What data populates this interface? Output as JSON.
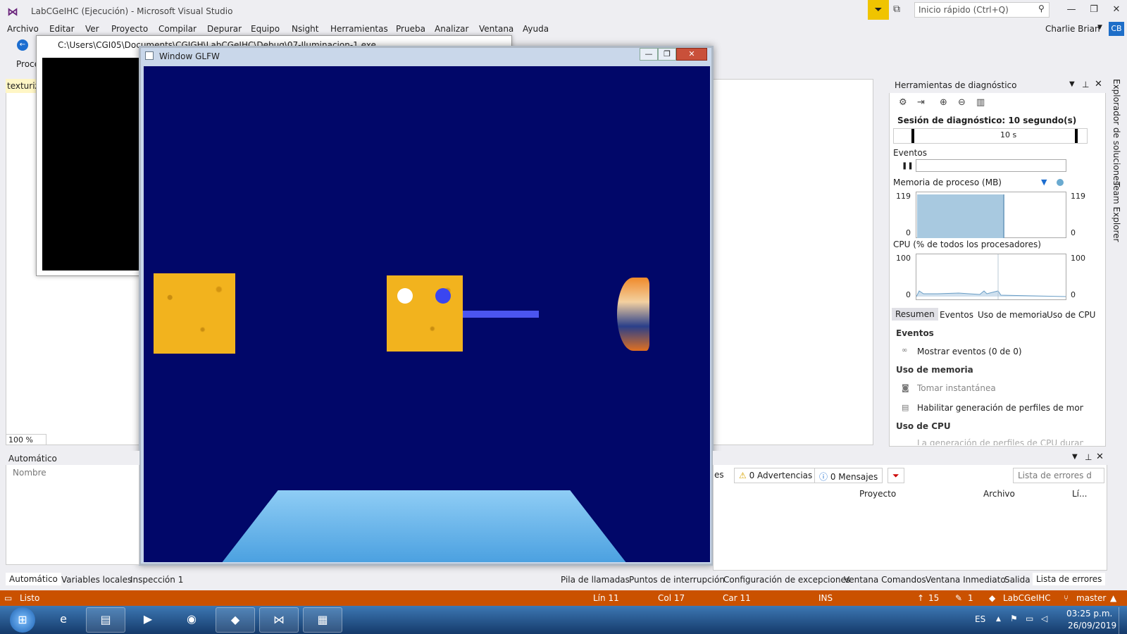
{
  "window": {
    "title": "LabCGeIHC (Ejecución) - Microsoft Visual Studio"
  },
  "quick_launch": {
    "placeholder": "Inicio rápido (Ctrl+Q)"
  },
  "menu": [
    "Archivo",
    "Editar",
    "Ver",
    "Proyecto",
    "Compilar",
    "Depurar",
    "Equipo",
    "Nsight",
    "Herramientas",
    "Prueba",
    "Analizar",
    "Ventana",
    "Ayuda"
  ],
  "user": {
    "name": "Charlie Brian",
    "initials": "CB"
  },
  "toolbar": {
    "process_label": "Proce"
  },
  "editor": {
    "tab": "texturiza",
    "zoom": "100 %"
  },
  "console": {
    "title": "C:\\Users\\CGI05\\Documents\\CGIGH\\LabCGeIHC\\Debug\\07-Iluminacion-1.exe"
  },
  "glfw": {
    "title": "Window GLFW"
  },
  "diagnostics": {
    "title": "Herramientas de diagnóstico",
    "session": "Sesión de diagnóstico: 10 segundo(s)",
    "time_label": "10 s",
    "events_label": "Eventos",
    "memory_label": "Memoria de proceso (MB)",
    "memory_max": "119",
    "memory_min": "0",
    "cpu_label": "CPU (% de todos los procesadores)",
    "cpu_max": "100",
    "cpu_min": "0",
    "tabs": [
      "Resumen",
      "Eventos",
      "Uso de memoria",
      "Uso de CPU"
    ],
    "events_section": "Eventos",
    "show_events": "Mostrar eventos (0 de 0)",
    "memory_section": "Uso de memoria",
    "take_snapshot": "Tomar instantánea",
    "enable_heap": "Habilitar generación de perfiles de montón (a",
    "cpu_section": "Uso de CPU",
    "cpu_note": "La generación de perfiles de CPU durante la d"
  },
  "sidebar_right": [
    "Explorador de soluciones",
    "Team Explorer"
  ],
  "autos": {
    "title": "Automático",
    "column": "Nombre"
  },
  "error_list": {
    "warnings": "0 Advertencias",
    "messages": "0 Mensajes",
    "errors_partial": "es",
    "search_placeholder": "Lista de errores d",
    "columns": [
      "Proyecto",
      "Archivo",
      "Lí..."
    ]
  },
  "bottom_tabs_left": [
    "Automático",
    "Variables locales",
    "Inspección 1"
  ],
  "bottom_tabs_right": [
    "Pila de llamadas",
    "Puntos de interrupción",
    "Configuración de excepciones",
    "Ventana Comandos",
    "Ventana Inmediato",
    "Salida",
    "Lista de errores"
  ],
  "status": {
    "state": "Listo",
    "line": "Lín 11",
    "col": "Col 17",
    "char": "Car 11",
    "mode": "INS",
    "push": "15",
    "edits": "1",
    "repo": "LabCGeIHC",
    "branch": "master"
  },
  "taskbar": {
    "lang": "ES",
    "time": "03:25 p.m.",
    "date": "26/09/2019"
  },
  "colors": {
    "status_bar": "#ca5100",
    "gl_background": "#010769",
    "accent": "#68217a"
  }
}
